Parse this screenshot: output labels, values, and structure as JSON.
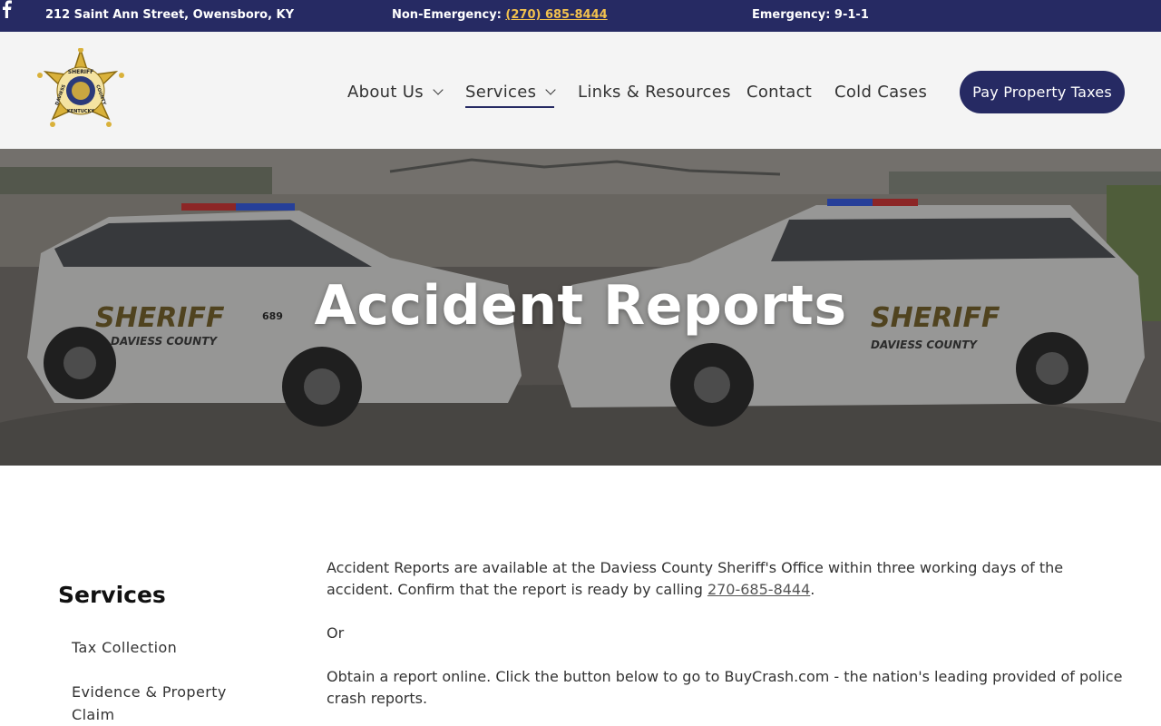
{
  "topbar": {
    "address": "212 Saint Ann Street, Owensboro, KY",
    "non_emergency_label": "Non-Emergency: ",
    "non_emergency_phone": "(270) 685-8444",
    "emergency": "Emergency: 9-1-1",
    "social_icon": "facebook-icon"
  },
  "logo": {
    "top_text": "SHERIFF",
    "left_text": "DAVIESS",
    "right_text": "COUNTY",
    "bottom_text": "KENTUCKY"
  },
  "nav": {
    "items": [
      {
        "label": "About Us",
        "has_dropdown": true
      },
      {
        "label": "Services",
        "has_dropdown": true,
        "active": true
      },
      {
        "label": "Links & Resources"
      },
      {
        "label": "Contact"
      },
      {
        "label": "Cold Cases"
      }
    ],
    "cta_label": "Pay Property Taxes"
  },
  "hero": {
    "title": "Accident Reports",
    "car_text_1": "SHERIFF",
    "car_text_2": "DAVIESS COUNTY",
    "car_number": "689"
  },
  "sidebar": {
    "title": "Services",
    "links": [
      "Tax Collection",
      "Evidence & Property",
      "Claim"
    ]
  },
  "content": {
    "p1_text": "Accident Reports are available at the Daviess County Sheriff's Office within three working days of the accident. Confirm that the report is ready by calling ",
    "p1_phone": "270-685-8444",
    "p1_end": ".",
    "p2": "Or",
    "p3": "Obtain a report online. Click the button below to go to BuyCrash.com - the nation's leading provided of police crash reports."
  },
  "colors": {
    "navy": "#262a63",
    "gold_link": "#f2c14e",
    "header_bg": "#f4f4f4"
  }
}
